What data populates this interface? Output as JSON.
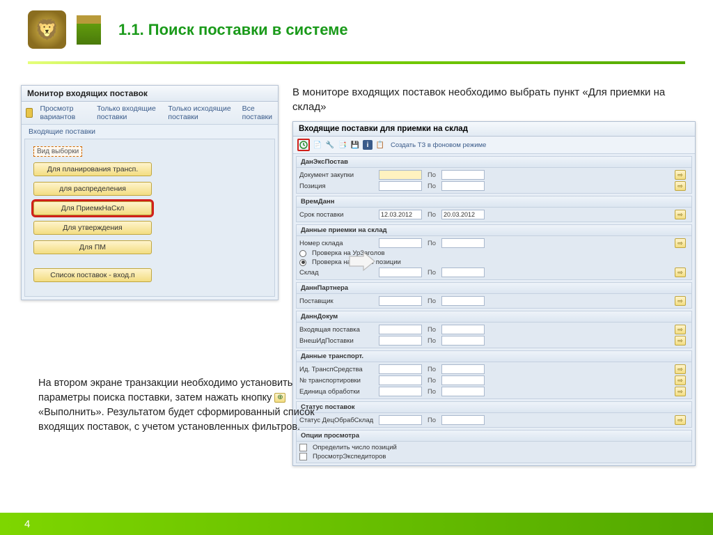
{
  "pageTitle": "1.1. Поиск поставки в системе",
  "pageNumber": "4",
  "win1": {
    "title": "Монитор входящих поставок",
    "toolbar": {
      "viewVariants": "Просмотр вариантов",
      "onlyIncoming": "Только входящие поставки",
      "onlyOutgoing": "Только исходящие поставки",
      "all": "Все поставки"
    },
    "frame": "Входящие поставки",
    "selectionLabel": "Вид выборки",
    "buttons": {
      "planning": "Для планирования трансп.",
      "distribution": "для распределения",
      "receiving": "Для ПриемкНаСкл",
      "approval": "Для утверждения",
      "pm": "Для ПМ",
      "list": "Список поставок - вход.п"
    }
  },
  "intro": "В мониторе входящих поставок необходимо выбрать пункт «Для приемки на склад»",
  "win2": {
    "title": "Входящие поставки для приемки на склад",
    "toolbarText": "Создать ТЗ в фоновом режиме",
    "groups": {
      "doc": {
        "title": "ДанЭксПостав",
        "fields": {
          "docPurchase": "Документ закупки",
          "position": "Позиция"
        }
      },
      "time": {
        "title": "ВремДанн",
        "fields": {
          "deliveryDate": "Срок поставки",
          "from": "12.03.2012",
          "to": "20.03.2012"
        }
      },
      "wh": {
        "title": "Данные приемки на склад",
        "fields": {
          "whNumber": "Номер склада",
          "checkHeader": "Проверка на УрЗаголов",
          "checkPos": "Проверка на уровне позиции",
          "warehouse": "Склад"
        }
      },
      "partner": {
        "title": "ДаннПартнера",
        "fields": {
          "supplier": "Поставщик"
        }
      },
      "docdata": {
        "title": "ДаннДокум",
        "fields": {
          "incoming": "Входящая поставка",
          "external": "ВнешИдПоставки"
        }
      },
      "transport": {
        "title": "Данные транспорт.",
        "fields": {
          "transId": "Ид. ТранспСредства",
          "transNo": "№ транспортировки",
          "unit": "Единица обработки"
        }
      },
      "status": {
        "title": "Статус поставок",
        "fields": {
          "status": "Статус ДецОбрабСклад"
        }
      },
      "view": {
        "title": "Опции просмотра",
        "fields": {
          "countPos": "Определить число позиций",
          "viewExp": "ПросмотрЭкспедиторов"
        }
      }
    },
    "sep": "По"
  },
  "note": {
    "part1": "На втором экране транзакции необходимо установить параметры поиска поставки, затем нажать кнопку ",
    "btnGlyph": "⊕",
    "part2": " «Выполнить». Результатом будет сформированный список входящих поставок, с учетом установленных фильтров."
  }
}
